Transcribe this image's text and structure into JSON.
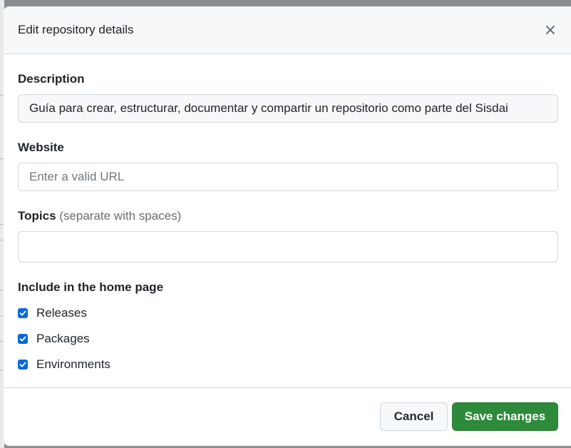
{
  "dialog": {
    "title": "Edit repository details"
  },
  "fields": {
    "description": {
      "label": "Description",
      "value": "Guía para crear, estructurar, documentar y compartir un repositorio como parte del Sisdai"
    },
    "website": {
      "label": "Website",
      "placeholder": "Enter a valid URL",
      "value": ""
    },
    "topics": {
      "label": "Topics",
      "hint": "(separate with spaces)",
      "value": ""
    }
  },
  "home_page": {
    "label": "Include in the home page",
    "options": [
      {
        "label": "Releases",
        "checked": true
      },
      {
        "label": "Packages",
        "checked": true
      },
      {
        "label": "Environments",
        "checked": true
      }
    ]
  },
  "footer": {
    "cancel_label": "Cancel",
    "save_label": "Save changes"
  },
  "colors": {
    "accent_checkbox": "#0969da",
    "save_button": "#2d8a3a"
  }
}
